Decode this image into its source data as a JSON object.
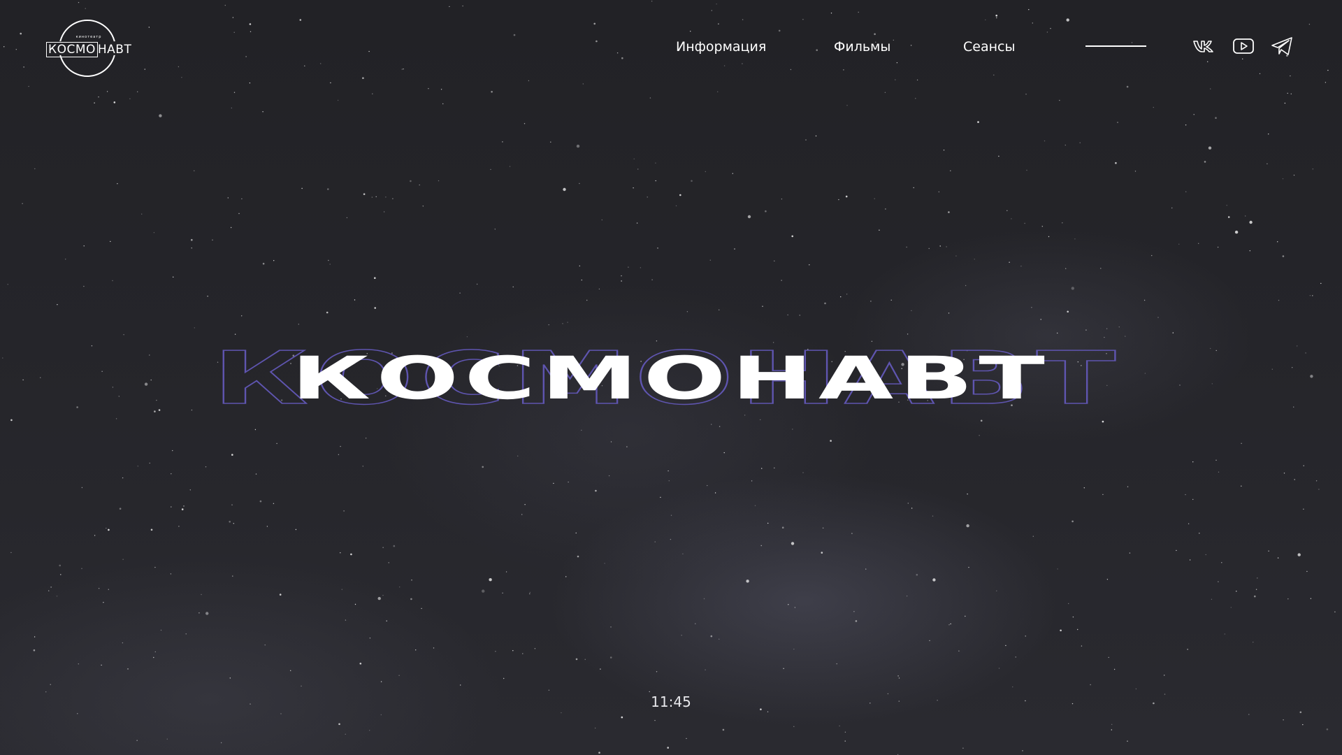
{
  "logo": {
    "small_text": "кинотеатр",
    "boxed_part": "КОСМО",
    "rest_part": "НАВТ"
  },
  "nav": {
    "items": [
      {
        "label": "Информация"
      },
      {
        "label": "Фильмы"
      },
      {
        "label": "Сеансы"
      }
    ]
  },
  "social": {
    "icons": [
      "vk-icon",
      "youtube-icon",
      "telegram-icon"
    ]
  },
  "hero": {
    "title": "КОСМОНАВТ",
    "outline_color": "#5f55b0"
  },
  "footer": {
    "time": "11:45"
  }
}
